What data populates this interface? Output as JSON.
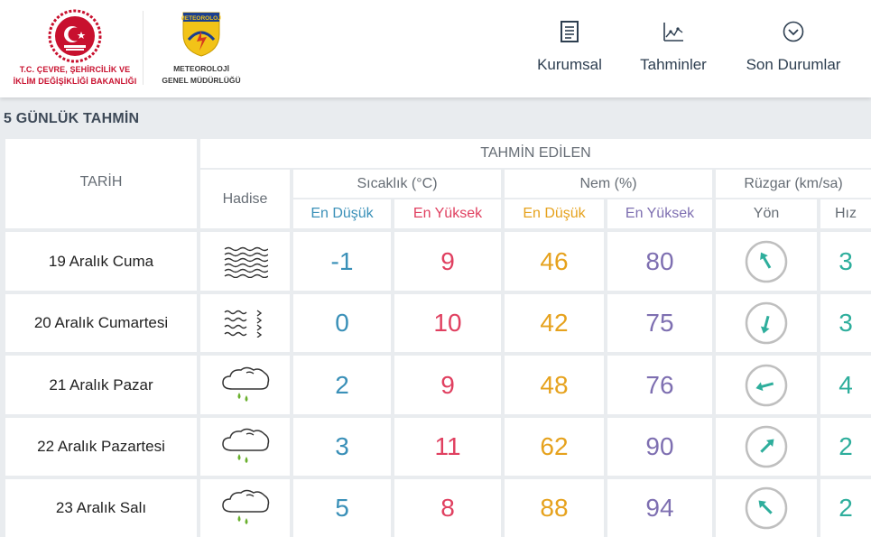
{
  "header": {
    "ministry_name_line1": "T.C. ÇEVRE, ŞEHİRCİLİK VE",
    "ministry_name_line2": "İKLİM DEĞİŞİKLİĞİ BAKANLIĞI",
    "mgm_badge": "METEOROLOJİ",
    "mgm_name_line1": "METEOROLOJİ",
    "mgm_name_line2": "GENEL MÜDÜRLÜĞÜ",
    "nav": [
      {
        "label": "Kurumsal",
        "icon": "document-icon"
      },
      {
        "label": "Tahminler",
        "icon": "chart-icon"
      },
      {
        "label": "Son Durumlar",
        "icon": "chevron-circle-icon"
      }
    ]
  },
  "page_title": "5 GÜNLÜK TAHMİN",
  "table": {
    "col_date": "TARİH",
    "col_forecast": "TAHMİN EDİLEN",
    "col_event": "Hadise",
    "col_temp": "Sıcaklık (°C)",
    "col_humidity": "Nem (%)",
    "col_wind": "Rüzgar (km/sa)",
    "sub_min": "En Düşük",
    "sub_max": "En Yüksek",
    "sub_dir": "Yön",
    "sub_speed": "Hız",
    "rows": [
      {
        "date": "19 Aralık Cuma",
        "event_icon": "fog-icon",
        "tmin": "-1",
        "tmax": "9",
        "hmin": "46",
        "hmax": "80",
        "wind_dir_deg": 330,
        "speed": "3"
      },
      {
        "date": "20 Aralık Cumartesi",
        "event_icon": "haze-icon",
        "tmin": "0",
        "tmax": "10",
        "hmin": "42",
        "hmax": "75",
        "wind_dir_deg": 195,
        "speed": "3"
      },
      {
        "date": "21 Aralık Pazar",
        "event_icon": "rain-cloud-icon",
        "tmin": "2",
        "tmax": "9",
        "hmin": "48",
        "hmax": "76",
        "wind_dir_deg": 255,
        "speed": "4"
      },
      {
        "date": "22 Aralık Pazartesi",
        "event_icon": "rain-cloud-icon",
        "tmin": "3",
        "tmax": "11",
        "hmin": "62",
        "hmax": "90",
        "wind_dir_deg": 45,
        "speed": "2"
      },
      {
        "date": "23 Aralık Salı",
        "event_icon": "rain-cloud-icon",
        "tmin": "5",
        "tmax": "8",
        "hmin": "88",
        "hmax": "94",
        "wind_dir_deg": 315,
        "speed": "2"
      }
    ]
  },
  "colors": {
    "min_temp": "#3a90b8",
    "max_temp": "#e04060",
    "min_humidity": "#e6a21d",
    "max_humidity": "#7e6fb1",
    "wind": "#2eae9c"
  }
}
